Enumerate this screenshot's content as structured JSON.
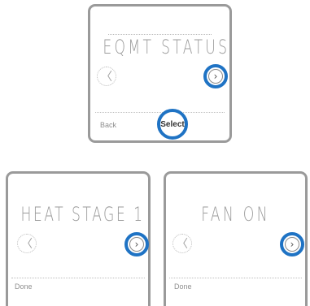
{
  "screens": [
    {
      "display": "EQMT STATUS",
      "left_arrow": "〈",
      "right_arrow": "›",
      "soft_left": "Back",
      "soft_center": "Select"
    },
    {
      "display": "HEAT STAGE 1",
      "left_arrow": "〈",
      "right_arrow": "›",
      "soft_left": "Done"
    },
    {
      "display": "FAN ON",
      "left_arrow": "〈",
      "right_arrow": "›",
      "soft_left": "Done"
    }
  ],
  "colors": {
    "highlight": "#1f73c4",
    "bezel": "#9a9a9a",
    "segment_text": "#9a9a9a"
  }
}
